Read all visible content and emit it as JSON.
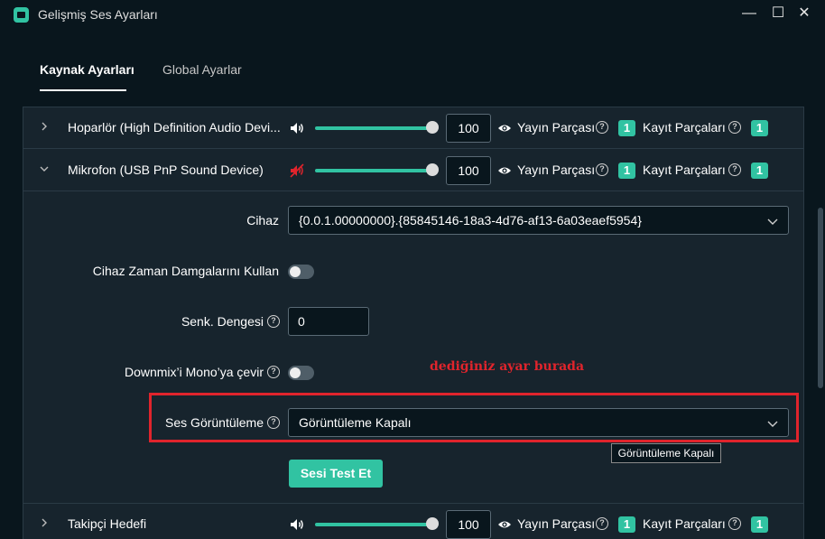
{
  "window": {
    "title": "Gelişmiş Ses Ayarları",
    "controls": {
      "minimize": "—",
      "maximize": "☐",
      "close": "✕"
    }
  },
  "tabs": [
    {
      "label": "Kaynak Ayarları",
      "active": true
    },
    {
      "label": "Global Ayarlar",
      "active": false
    }
  ],
  "sources": [
    {
      "name": "Hoparlör (High Definition Audio Devi...",
      "volume": "100",
      "muted": false,
      "expanded": false,
      "stream_label": "Yayın Parçası",
      "stream_track": "1",
      "record_label": "Kayıt Parçaları",
      "record_track": "1"
    },
    {
      "name": "Mikrofon (USB PnP Sound Device)",
      "volume": "100",
      "muted": true,
      "expanded": true,
      "stream_label": "Yayın Parçası",
      "stream_track": "1",
      "record_label": "Kayıt Parçaları",
      "record_track": "1"
    },
    {
      "name": "Takipçi Hedefi",
      "volume": "100",
      "muted": false,
      "expanded": false,
      "stream_label": "Yayın Parçası",
      "stream_track": "1",
      "record_label": "Kayıt Parçaları",
      "record_track": "1"
    }
  ],
  "mic_settings": {
    "device_label": "Cihaz",
    "device_value": "{0.0.1.00000000}.{85845146-18a3-4d76-af13-6a03eaef5954}",
    "timestamps_label": "Cihaz Zaman Damgalarını Kullan",
    "timestamps_on": false,
    "sync_offset_label": "Senk. Dengesi",
    "sync_offset_value": "0",
    "downmix_label": "Downmix’i Mono’ya çevir",
    "downmix_on": false,
    "monitoring_label": "Ses Görüntüleme",
    "monitoring_value": "Görüntüleme Kapalı",
    "monitoring_tooltip": "Görüntüleme Kapalı",
    "test_button": "Sesi Test Et"
  },
  "annotation": {
    "text": "dediğiniz ayar burada",
    "color": "#e0242c"
  },
  "colors": {
    "accent": "#31c3a2",
    "background": "#09161d",
    "panel": "#17242d"
  },
  "icons": {
    "help": "?"
  }
}
